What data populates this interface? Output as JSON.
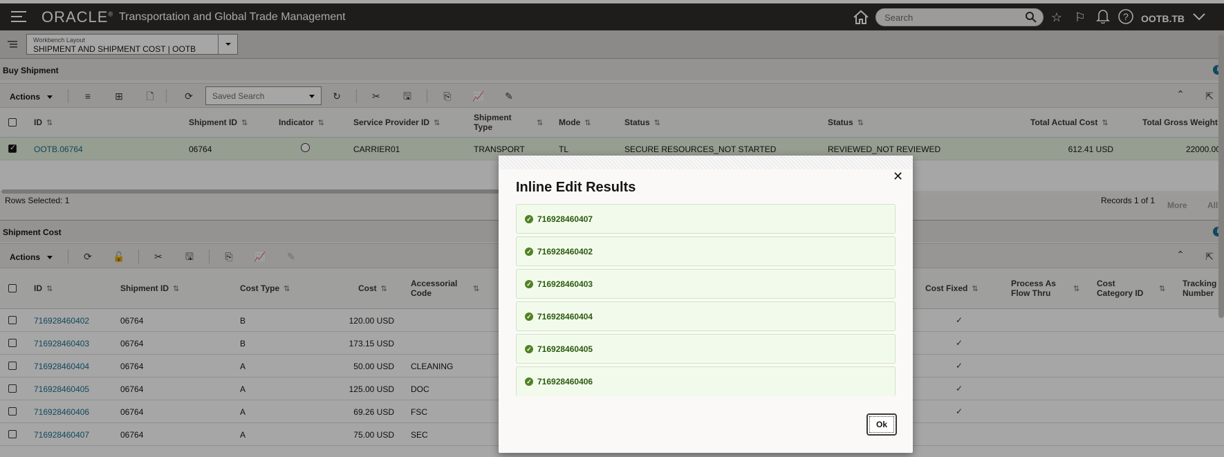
{
  "header": {
    "logo": "ORACLE",
    "app_title": "Transportation and Global Trade Management",
    "search_placeholder": "Search",
    "username": "OOTB.TB"
  },
  "layout": {
    "label": "Workbench Layout",
    "value": "SHIPMENT AND SHIPMENT COST | OOTB"
  },
  "buy_shipment": {
    "title": "Buy Shipment",
    "actions_label": "Actions",
    "saved_search": "Saved Search",
    "columns": [
      "ID",
      "Shipment ID",
      "Indicator",
      "Service Provider ID",
      "Shipment Type",
      "Mode",
      "Status",
      "Status",
      "Total Actual Cost",
      "Total Gross Weight"
    ],
    "rows": [
      {
        "id": "OOTB.06764",
        "shipment_id": "06764",
        "provider": "CARRIER01",
        "type": "TRANSPORT",
        "mode": "TL",
        "status1": "SECURE RESOURCES_NOT STARTED",
        "status2": "REVIEWED_NOT REVIEWED",
        "cost": "612.41 USD",
        "weight": "22000.00"
      }
    ],
    "rows_selected": "Rows Selected: 1",
    "records": "Records 1 of 1",
    "more": "More",
    "all": "All"
  },
  "shipment_cost": {
    "title": "Shipment Cost",
    "actions_label": "Actions",
    "columns": [
      "ID",
      "Shipment ID",
      "Cost Type",
      "Cost",
      "Accessorial Code",
      "Cost Fixed",
      "Process As Flow Thru",
      "Cost Category ID",
      "Tracking Number"
    ],
    "rows": [
      {
        "id": "716928460402",
        "shipment_id": "06764",
        "cost_type": "B",
        "cost": "120.00 USD",
        "acc": "",
        "fixed": true
      },
      {
        "id": "716928460403",
        "shipment_id": "06764",
        "cost_type": "B",
        "cost": "173.15 USD",
        "acc": "",
        "fixed": true
      },
      {
        "id": "716928460404",
        "shipment_id": "06764",
        "cost_type": "A",
        "cost": "50.00 USD",
        "acc": "CLEANING",
        "fixed": true
      },
      {
        "id": "716928460405",
        "shipment_id": "06764",
        "cost_type": "A",
        "cost": "125.00 USD",
        "acc": "DOC",
        "fixed": true
      },
      {
        "id": "716928460406",
        "shipment_id": "06764",
        "cost_type": "A",
        "cost": "69.26 USD",
        "acc": "FSC",
        "fixed": true
      },
      {
        "id": "716928460407",
        "shipment_id": "06764",
        "cost_type": "A",
        "cost": "75.00 USD",
        "acc": "SEC",
        "fixed": false
      }
    ]
  },
  "dialog": {
    "title": "Inline Edit Results",
    "messages": [
      "716928460407",
      "716928460402",
      "716928460403",
      "716928460404",
      "716928460405",
      "716928460406"
    ],
    "ok_label": "Ok"
  }
}
